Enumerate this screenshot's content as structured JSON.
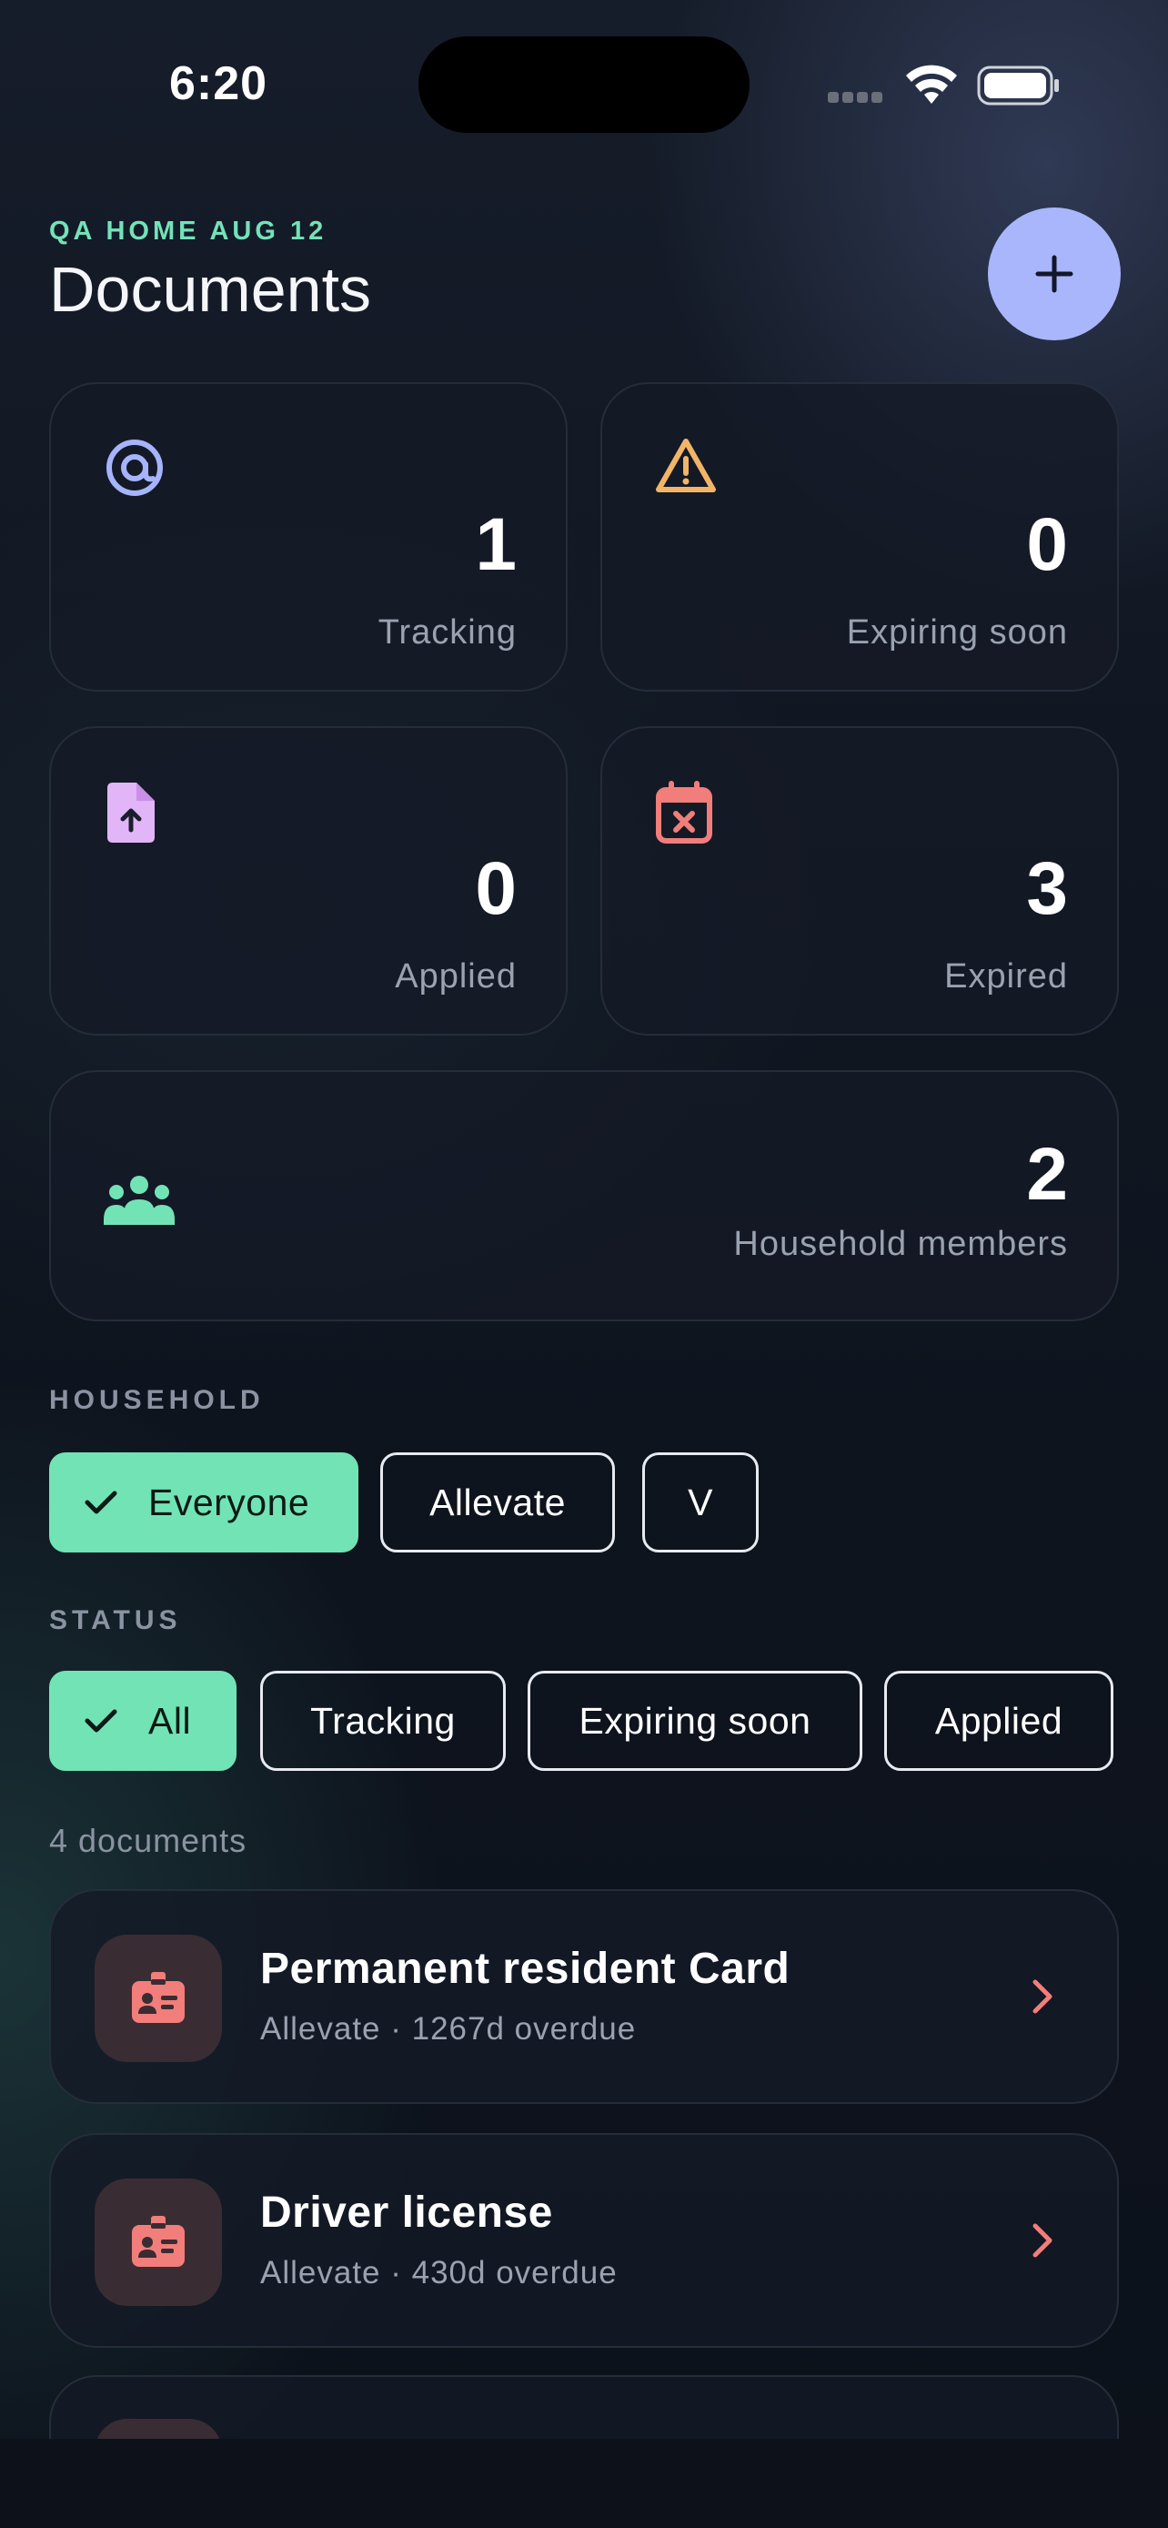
{
  "status_bar": {
    "time": "6:20"
  },
  "header": {
    "eyebrow": "QA HOME AUG 12",
    "title": "Documents",
    "add_label": "+"
  },
  "stats": {
    "tracking": {
      "value": "1",
      "label": "Tracking",
      "icon": "at-target-icon",
      "color": "#a6b4fb"
    },
    "expiring": {
      "value": "0",
      "label": "Expiring soon",
      "icon": "warning-triangle-icon",
      "color": "#f2b567"
    },
    "applied": {
      "value": "0",
      "label": "Applied",
      "icon": "file-upload-icon",
      "color": "#e1b5f7"
    },
    "expired": {
      "value": "3",
      "label": "Expired",
      "icon": "calendar-x-icon",
      "color": "#f17e7a"
    },
    "household": {
      "value": "2",
      "label": "Household members",
      "icon": "people-group-icon",
      "color": "#72e3b5"
    }
  },
  "household_filter": {
    "label": "HOUSEHOLD",
    "chips": [
      {
        "label": "Everyone",
        "active": true
      },
      {
        "label": "Allevate",
        "active": false
      },
      {
        "label": "V",
        "active": false
      }
    ]
  },
  "status_filter": {
    "label": "STATUS",
    "chips": [
      {
        "label": "All",
        "active": true
      },
      {
        "label": "Tracking",
        "active": false
      },
      {
        "label": "Expiring soon",
        "active": false
      },
      {
        "label": "Applied",
        "active": false
      }
    ]
  },
  "documents": {
    "count_label": "4 documents",
    "items": [
      {
        "title": "Permanent resident Card",
        "subtitle": "Allevate · 1267d overdue",
        "icon": "id-badge-icon"
      },
      {
        "title": "Driver license",
        "subtitle": "Allevate · 430d overdue",
        "icon": "id-badge-icon"
      }
    ]
  },
  "colors": {
    "accent_green": "#72e3b5",
    "fab_blue": "#a9b6fb",
    "overdue_red": "#f17e7a"
  }
}
